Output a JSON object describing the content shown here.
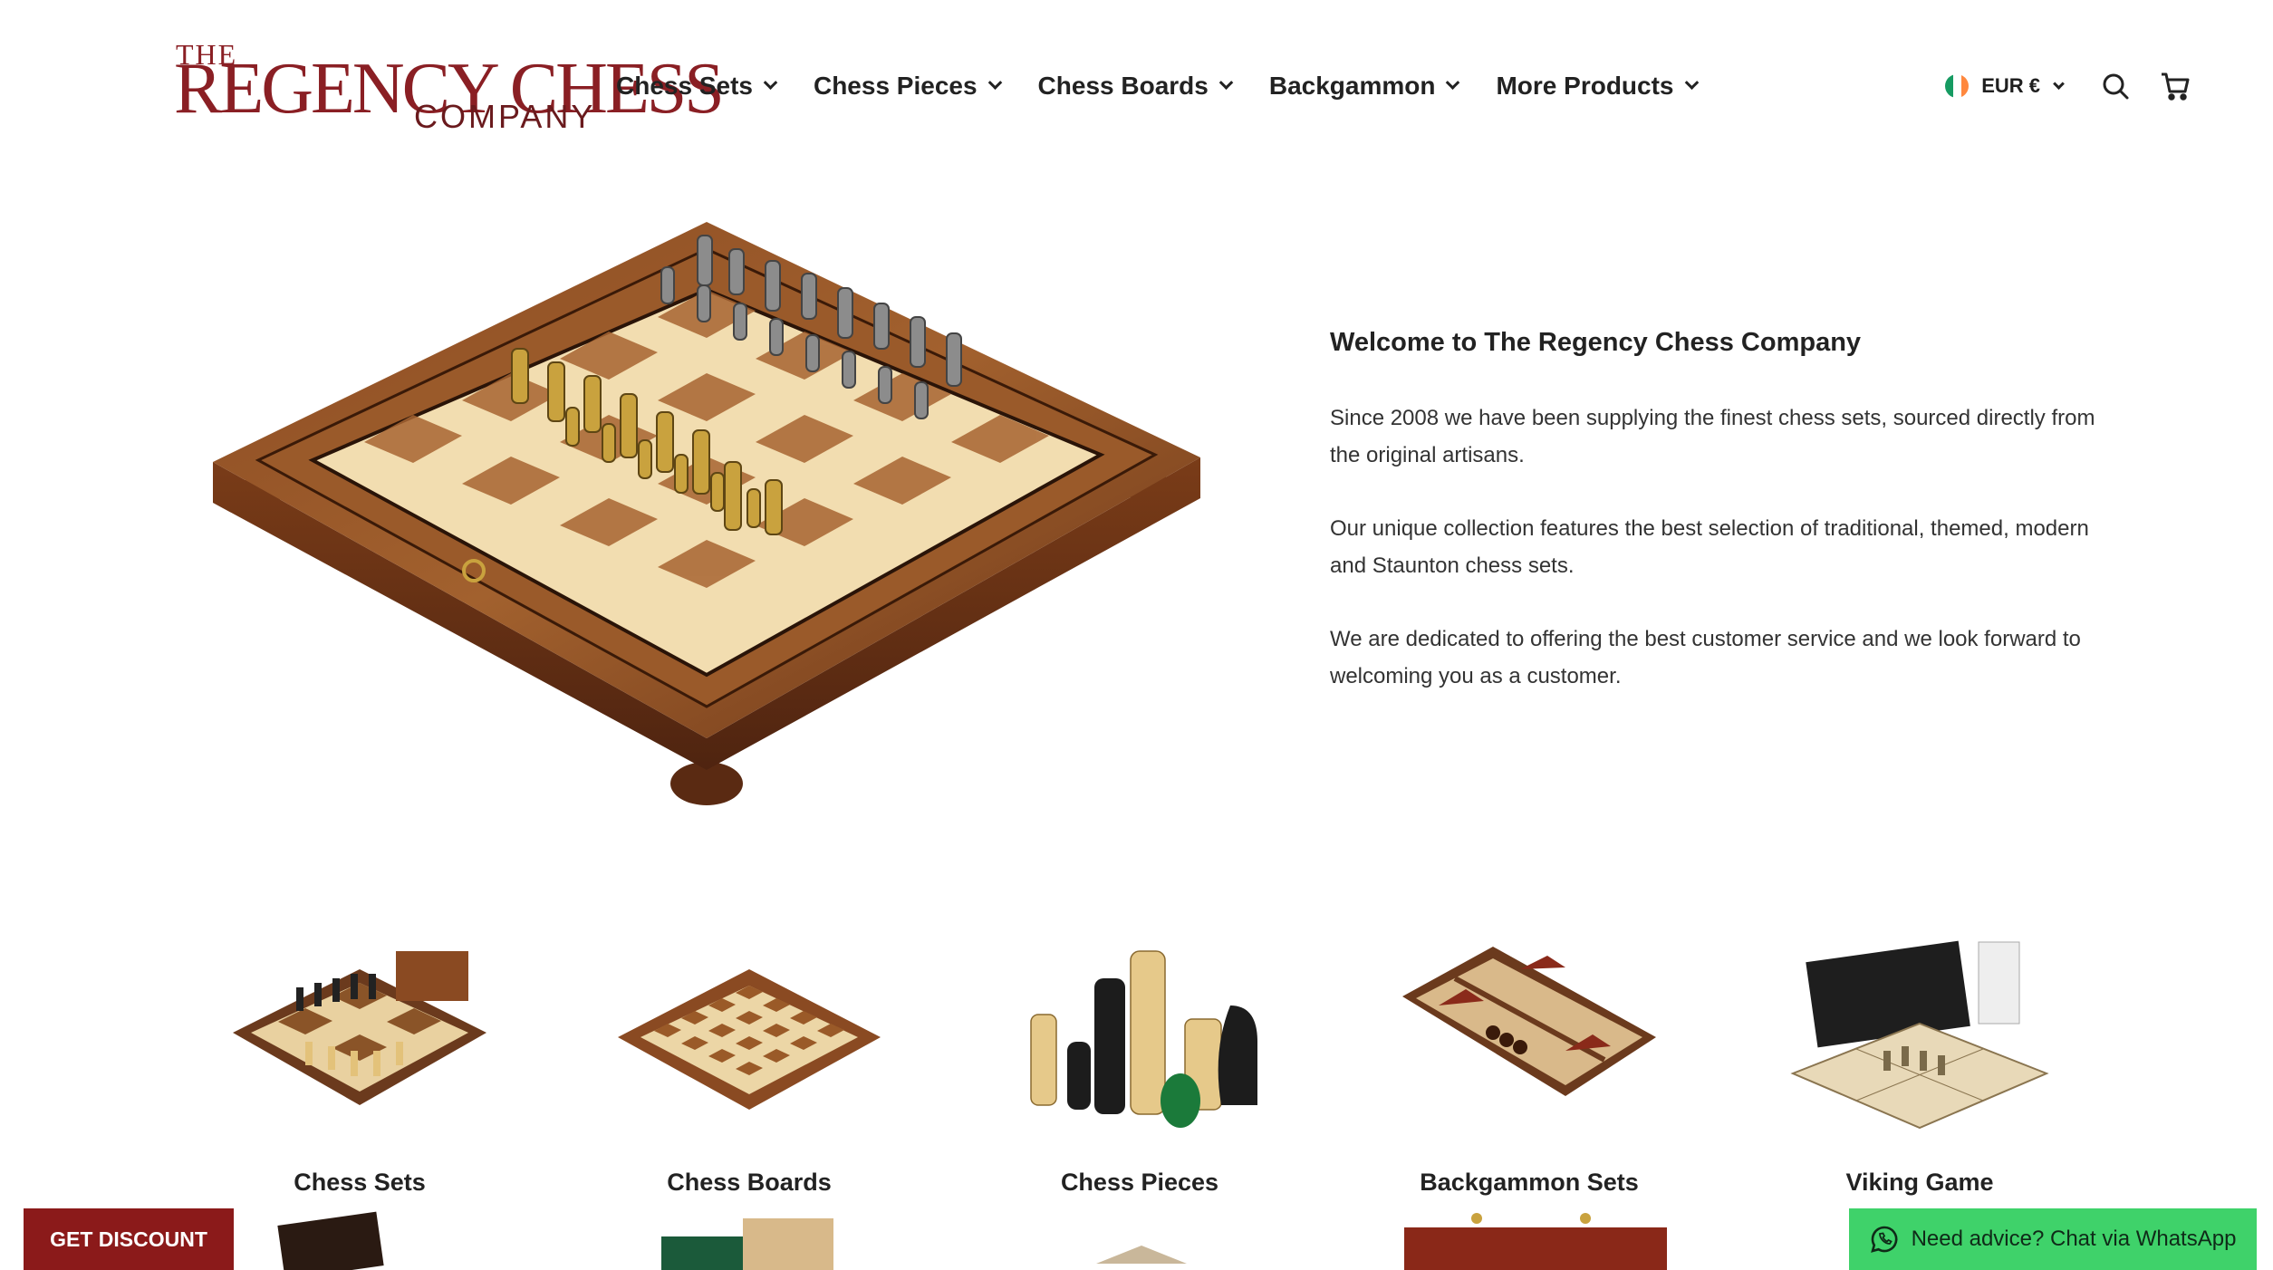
{
  "brand": {
    "logo_the": "THE",
    "logo_main": "REGENCY CHESS",
    "logo_company": "COMPANY",
    "color": "#8a1f24"
  },
  "nav": {
    "items": [
      {
        "label": "Chess Sets"
      },
      {
        "label": "Chess Pieces"
      },
      {
        "label": "Chess Boards"
      },
      {
        "label": "Backgammon"
      },
      {
        "label": "More Products"
      }
    ]
  },
  "tools": {
    "currency": "EUR €",
    "flag_colors": [
      "#169b62",
      "#ffffff",
      "#ff883e"
    ],
    "search_icon": "search-icon",
    "cart_icon": "cart-icon"
  },
  "hero": {
    "heading": "Welcome to The Regency Chess Company",
    "paragraphs": [
      "Since 2008 we have been supplying the finest chess sets, sourced directly from the original artisans.",
      "Our unique collection features the best selection of traditional, themed, modern and Staunton chess sets.",
      "We are dedicated to offering the best customer service and we look forward to welcoming you as a customer."
    ]
  },
  "categories": [
    {
      "label": "Chess Sets"
    },
    {
      "label": "Chess Boards"
    },
    {
      "label": "Chess Pieces"
    },
    {
      "label": "Backgammon Sets"
    },
    {
      "label": "Viking Game"
    }
  ],
  "floating": {
    "discount_label": "GET DISCOUNT",
    "whatsapp_label": "Need advice? Chat via WhatsApp",
    "discount_color": "#8b1a1a",
    "whatsapp_color": "#3fd26a"
  }
}
